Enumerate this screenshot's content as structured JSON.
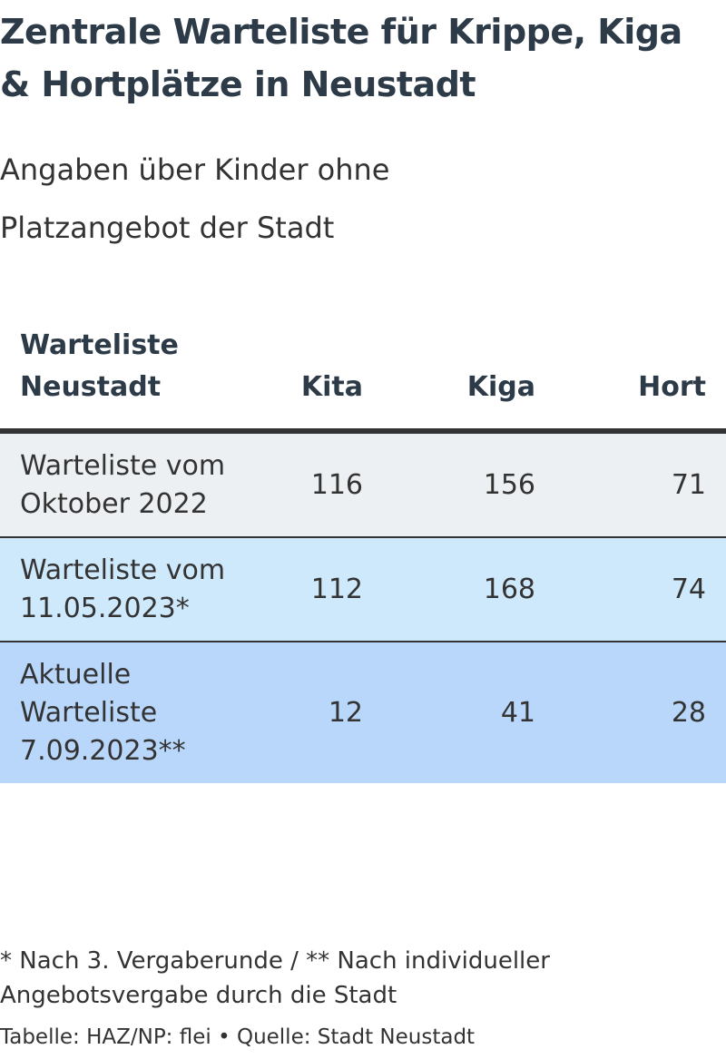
{
  "title": "Zentrale Warteliste für Krippe, Kiga & Hortplätze in Neustadt",
  "subtitle": "Angaben über Kinder ohne Platzangebot der Stadt",
  "chart_data": {
    "type": "table",
    "columns": [
      "Warteliste Neustadt",
      "Kita",
      "Kiga",
      "Hort"
    ],
    "rows": [
      {
        "label": "Warteliste vom Oktober 2022",
        "values": [
          116,
          156,
          71
        ]
      },
      {
        "label": "Warteliste vom 11.05.2023*",
        "values": [
          112,
          168,
          74
        ]
      },
      {
        "label": "Aktuelle Warteliste 7.09.2023**",
        "values": [
          12,
          41,
          28
        ]
      }
    ],
    "row_colors": [
      "#edf0f3",
      "#cfe9fc",
      "#b9d7fb"
    ]
  },
  "footnote": "* Nach 3. Vergaberunde / ** Nach individueller Angebotsvergabe durch die Stadt",
  "source": "Tabelle: HAZ/NP: flei • Quelle: Stadt Neustadt"
}
